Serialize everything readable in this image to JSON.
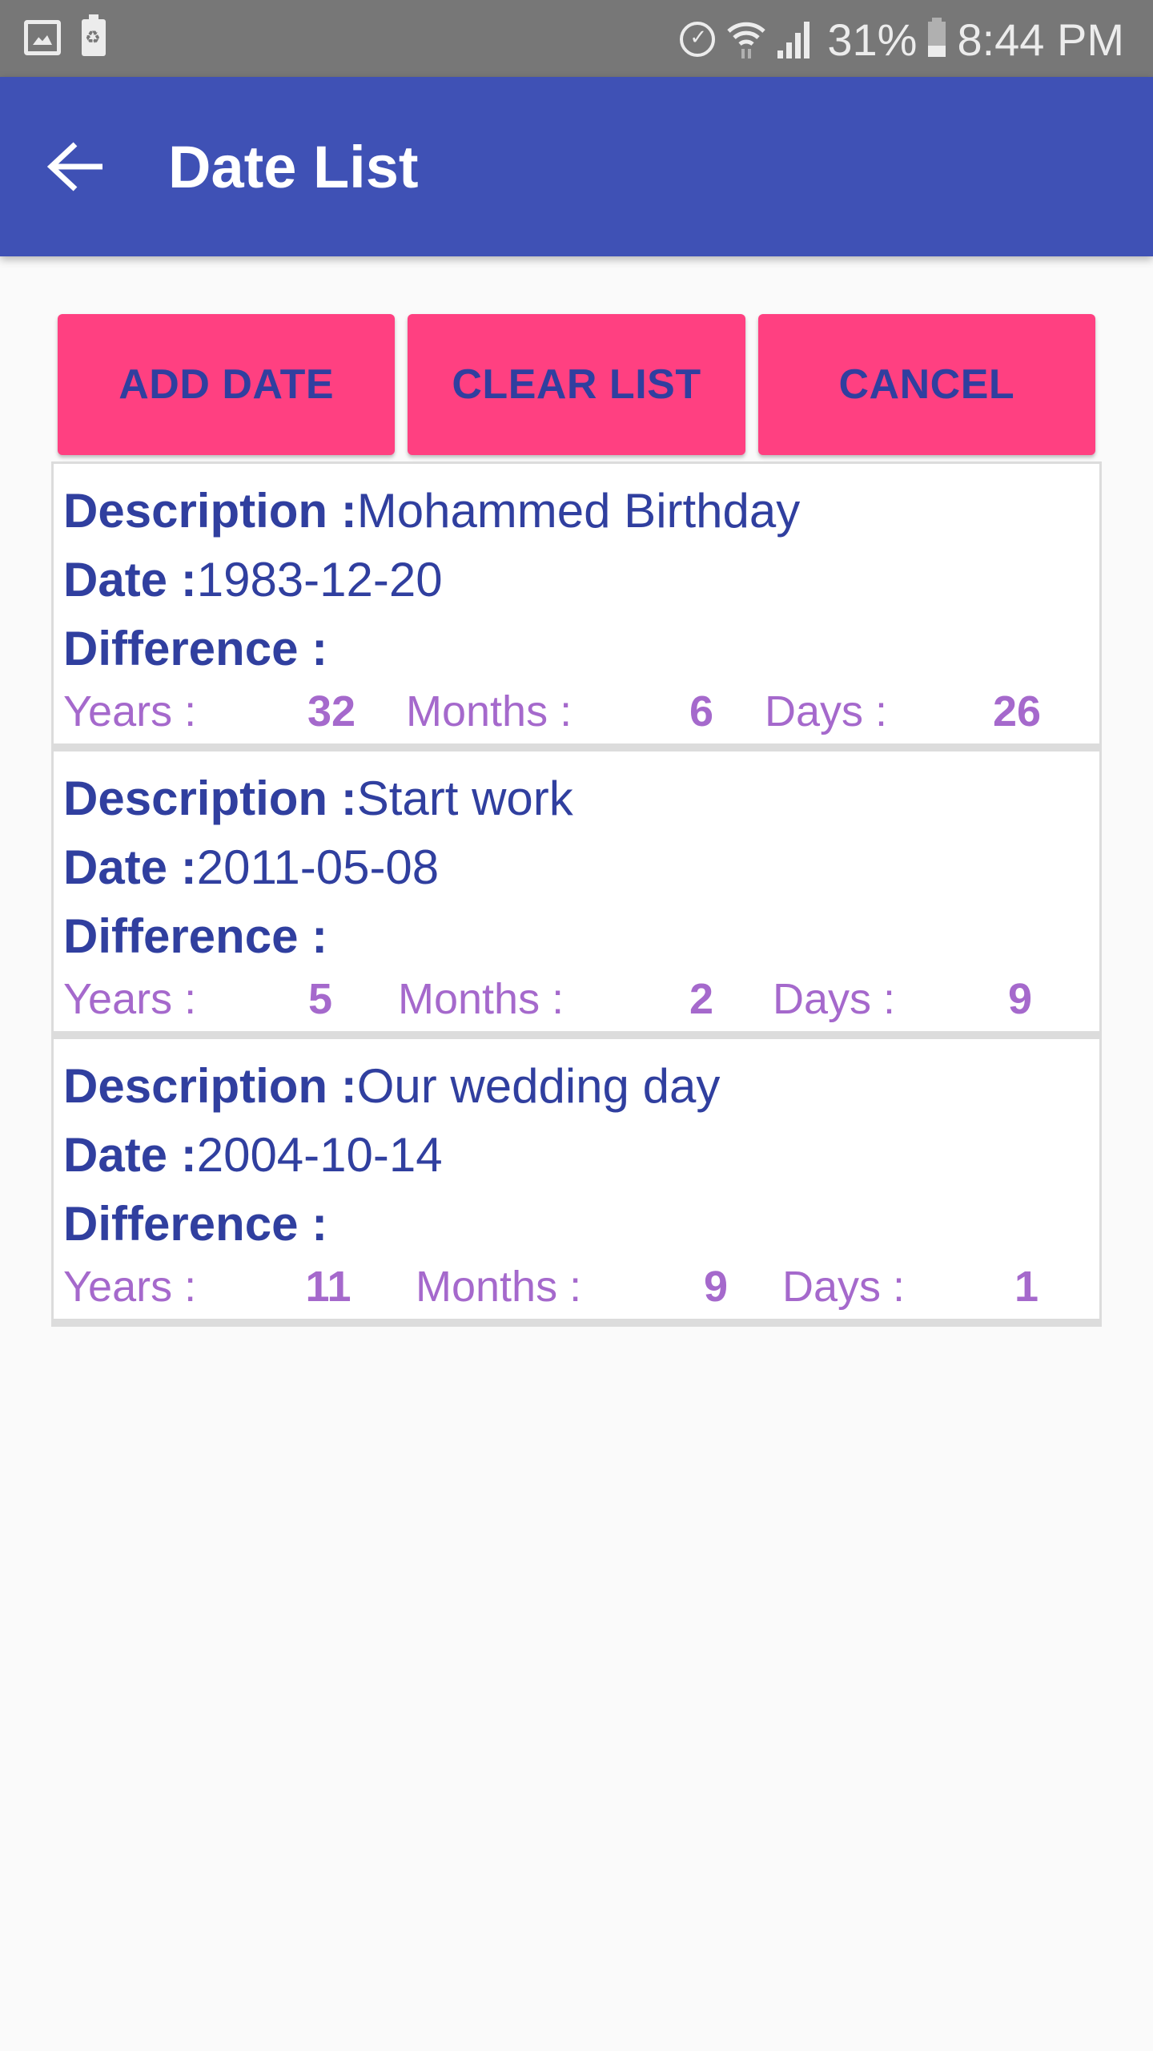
{
  "status_bar": {
    "left_icons": [
      "gallery-icon",
      "battery-saver-icon"
    ],
    "right_icons": [
      "alarm-icon",
      "wifi-icon",
      "signal-icon",
      "battery-icon"
    ],
    "battery_percent": "31%",
    "time": "8:44 PM"
  },
  "app_bar": {
    "back_icon": "arrow-left-icon",
    "title": "Date List"
  },
  "buttons": {
    "add_date": "ADD DATE",
    "clear_list": "CLEAR LIST",
    "cancel": "CANCEL"
  },
  "labels": {
    "description": "Description :",
    "date": "Date :",
    "difference": "Difference :",
    "years": "Years :",
    "months": "Months :",
    "days": "Days :"
  },
  "entries": [
    {
      "description": "Mohammed Birthday",
      "date": "1983-12-20",
      "years": "32",
      "months": "6",
      "days": "26"
    },
    {
      "description": "Start work",
      "date": "2011-05-08",
      "years": "5",
      "months": "2",
      "days": "9"
    },
    {
      "description": "Our wedding day",
      "date": "2004-10-14",
      "years": "11",
      "months": "9",
      "days": "1"
    }
  ],
  "colors": {
    "primary": "#3f51b5",
    "accent": "#ff4081",
    "text_primary": "#303f9f",
    "difference_text": "#a569cc",
    "status_bar": "#777777",
    "background": "#fafafa"
  }
}
